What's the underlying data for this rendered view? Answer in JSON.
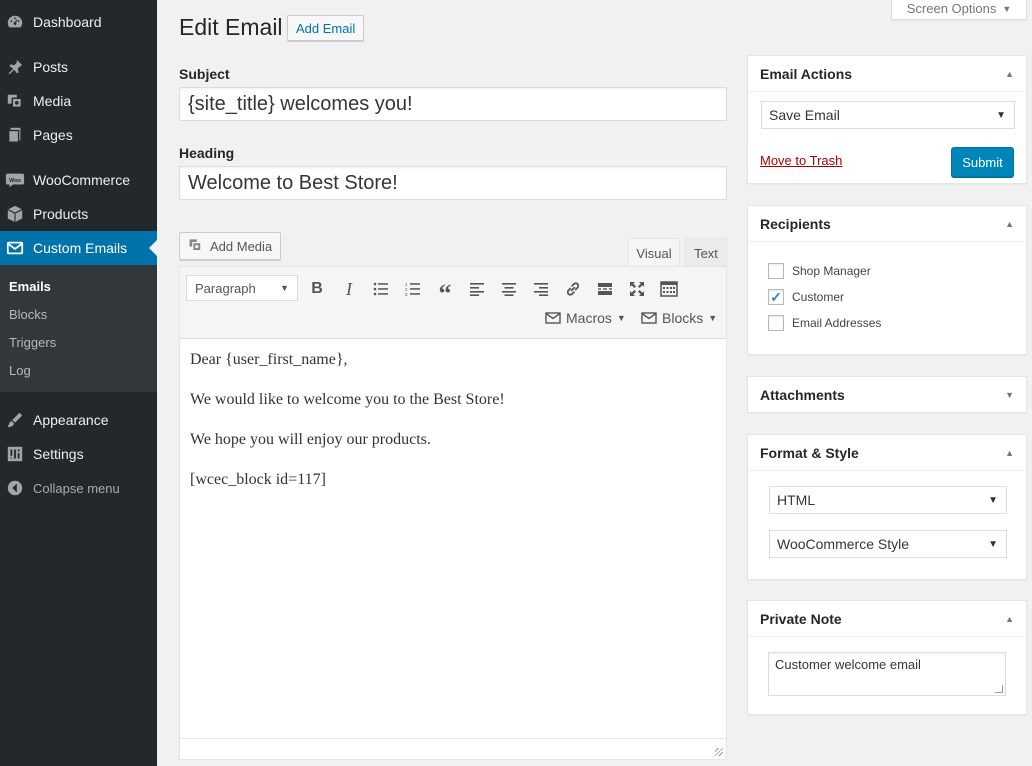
{
  "sidebar": {
    "items": [
      {
        "label": "Dashboard",
        "icon": "dashboard-icon"
      },
      {
        "label": "Posts",
        "icon": "pin-icon"
      },
      {
        "label": "Media",
        "icon": "media-icon"
      },
      {
        "label": "Pages",
        "icon": "pages-icon"
      },
      {
        "label": "WooCommerce",
        "icon": "woocommerce-icon"
      },
      {
        "label": "Products",
        "icon": "products-icon"
      },
      {
        "label": "Custom Emails",
        "icon": "email-icon"
      },
      {
        "label": "Appearance",
        "icon": "appearance-icon"
      },
      {
        "label": "Settings",
        "icon": "settings-icon"
      },
      {
        "label": "Collapse menu",
        "icon": "collapse-icon"
      }
    ],
    "submenu": [
      "Emails",
      "Blocks",
      "Triggers",
      "Log"
    ],
    "active_item": "Custom Emails",
    "current_subitem": "Emails",
    "colors": {
      "background": "#23282d",
      "active": "#0073aa",
      "submenu": "#32373c"
    }
  },
  "header": {
    "title": "Edit Email",
    "add_button": "Add Email",
    "screen_options": "Screen Options"
  },
  "form": {
    "subject_label": "Subject",
    "subject_value": "{site_title} welcomes you!",
    "heading_label": "Heading",
    "heading_value": "Welcome to Best Store!"
  },
  "editor": {
    "add_media": "Add Media",
    "tab_visual": "Visual",
    "tab_text": "Text",
    "format_select": "Paragraph",
    "macros_label": "Macros",
    "blocks_label": "Blocks",
    "content": [
      "Dear {user_first_name},",
      "We would like to welcome you to the Best Store!",
      "We hope you will enjoy our products.",
      "[wcec_block id=117]"
    ]
  },
  "email_actions": {
    "title": "Email Actions",
    "action_select": "Save Email",
    "move_to_trash": "Move to Trash",
    "submit": "Submit"
  },
  "recipients": {
    "title": "Recipients",
    "options": [
      {
        "label": "Shop Manager",
        "checked": false
      },
      {
        "label": "Customer",
        "checked": true
      },
      {
        "label": "Email Addresses",
        "checked": false
      }
    ]
  },
  "attachments": {
    "title": "Attachments"
  },
  "format_style": {
    "title": "Format & Style",
    "format_select": "HTML",
    "style_select": "WooCommerce Style"
  },
  "private_note": {
    "title": "Private Note",
    "note_value": "Customer welcome email"
  },
  "colors": {
    "accent": "#0073aa",
    "button_primary": "#0085ba",
    "trash_link": "#a00"
  }
}
